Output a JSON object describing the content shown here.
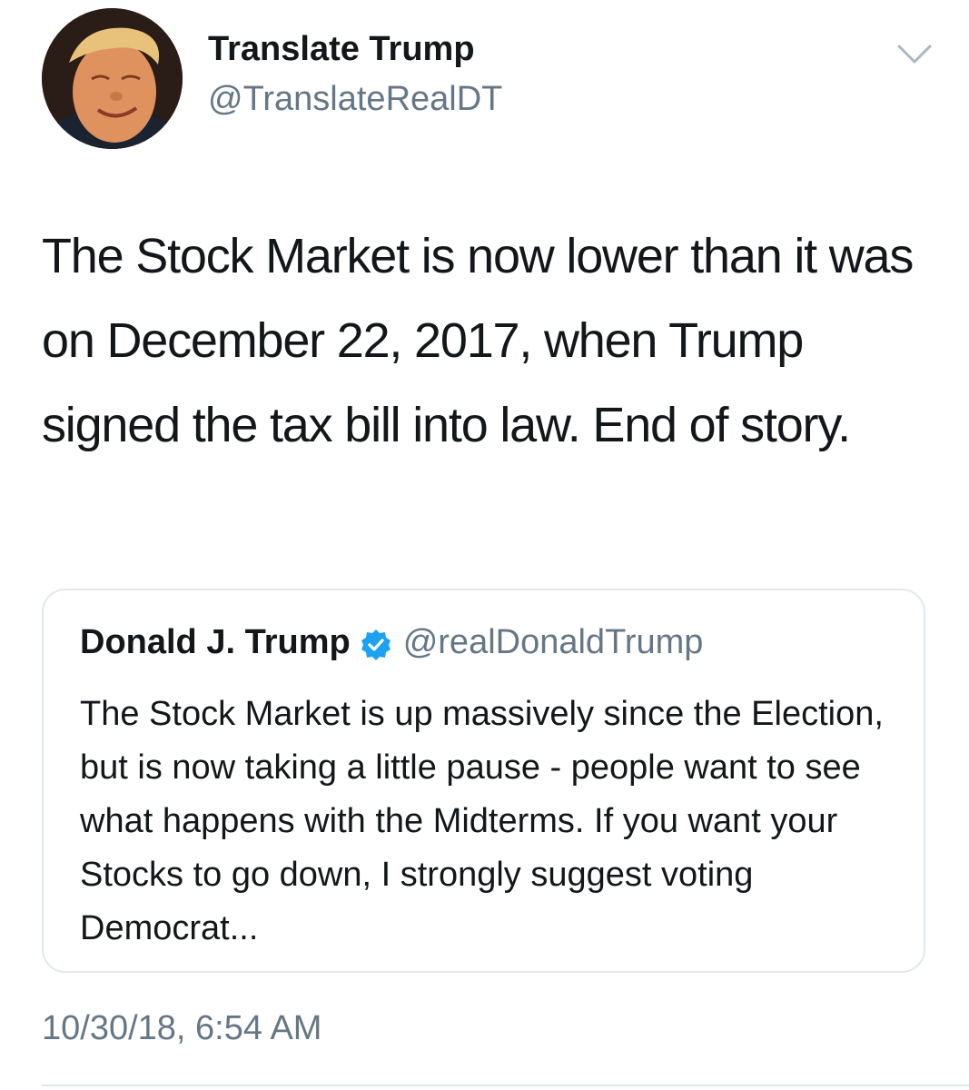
{
  "tweet": {
    "author": {
      "display_name": "Translate Trump",
      "handle": "@TranslateRealDT",
      "avatar": "profile-photo"
    },
    "menu_icon": "chevron-down-icon",
    "text": "The Stock Market is now lower than it was on December 22, 2017, when Trump signed the tax bill into law. End of story.",
    "quoted_tweet": {
      "display_name": "Donald J. Trump",
      "verified_icon": "verified-badge-icon",
      "handle": "@realDonaldTrump",
      "text": "The Stock Market is up massively since the Election, but is now taking a little pause - people want to see what happens with the Midterms. If you want your Stocks to go down, I strongly suggest voting Democrat..."
    },
    "timestamp": "10/30/18, 6:54 AM"
  },
  "colors": {
    "text_primary": "#14171a",
    "text_secondary": "#657786",
    "border": "#e1e8ed",
    "verified_blue": "#1da1f2"
  }
}
